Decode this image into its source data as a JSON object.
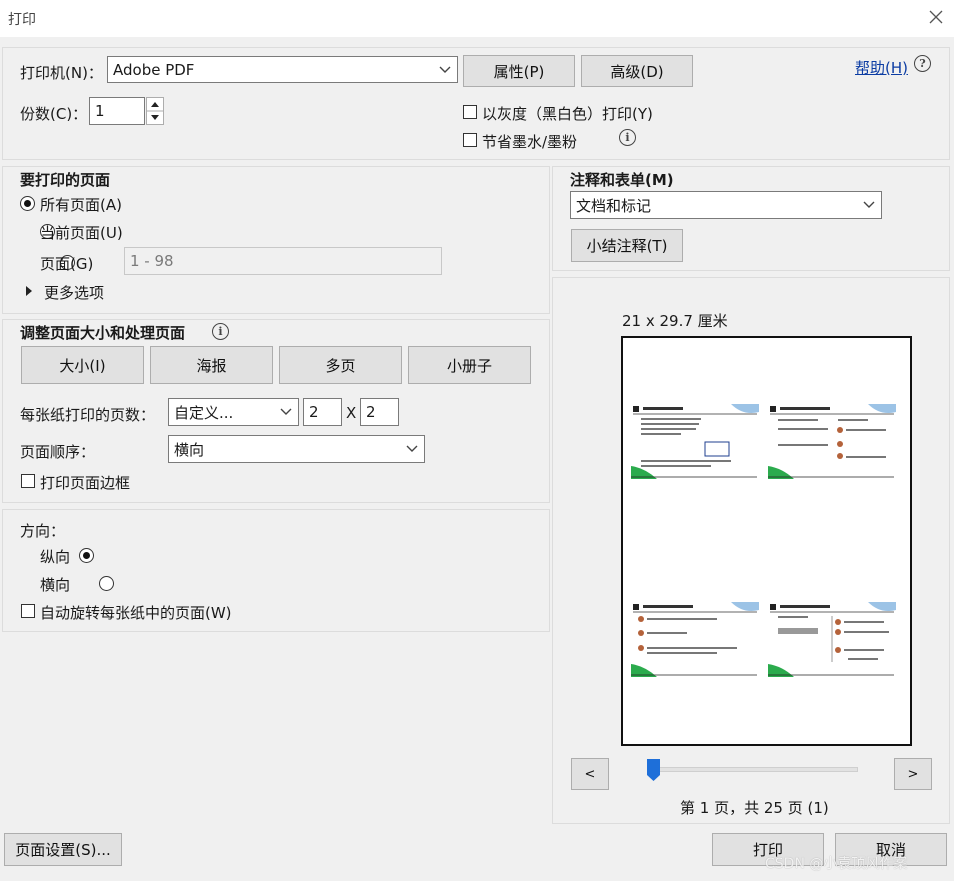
{
  "window": {
    "title": "打印"
  },
  "printer": {
    "label": "打印机(N)：",
    "selected": "Adobe PDF",
    "properties_button": "属性(P)",
    "advanced_button": "高级(D)",
    "help_link": "帮助(H)",
    "copies_label": "份数(C)：",
    "copies_value": "1",
    "grayscale_label": "以灰度（黑白色）打印(Y)",
    "save_ink_label": "节省墨水/墨粉"
  },
  "pages_to_print": {
    "heading": "要打印的页面",
    "all_pages": "所有页面(A)",
    "current_page": "当前页面(U)",
    "pages": "页面(G)",
    "pages_range_placeholder": "1 - 98",
    "more_options": "更多选项"
  },
  "page_sizing": {
    "heading": "调整页面大小和处理页面",
    "size_button": "大小(I)",
    "poster_button": "海报",
    "multiple_button": "多页",
    "booklet_button": "小册子",
    "pages_per_sheet_label": "每张纸打印的页数：",
    "pages_per_sheet_value": "自定义...",
    "cols_value": "2",
    "times": "X",
    "rows_value": "2",
    "page_order_label": "页面顺序：",
    "page_order_value": "横向",
    "print_border_label": "打印页面边框"
  },
  "orientation": {
    "heading": "方向：",
    "portrait": "纵向",
    "landscape": "横向",
    "auto_rotate": "自动旋转每张纸中的页面(W)"
  },
  "comments_forms": {
    "heading": "注释和表单(M)",
    "selected": "文档和标记",
    "summarize_button": "小结注释(T)"
  },
  "preview": {
    "paper_size": "21 x 29.7 厘米",
    "prev_button": "<",
    "next_button": ">",
    "page_info": "第 1 页，共 25 页 (1)",
    "slider_position": 0.0
  },
  "footer": {
    "page_setup_button": "页面设置(S)...",
    "print_button": "打印",
    "cancel_button": "取消",
    "watermark": "CSDN @小袁顶风作案"
  }
}
